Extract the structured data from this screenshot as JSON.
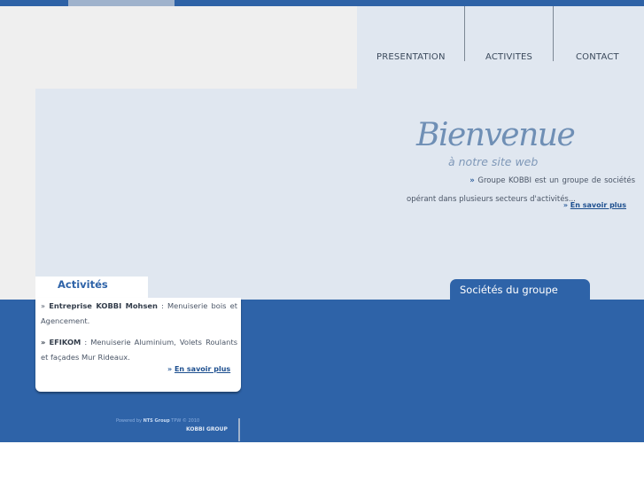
{
  "nav": {
    "items": [
      {
        "label": "PRESENTATION"
      },
      {
        "label": "ACTIVITES"
      },
      {
        "label": "CONTACT"
      }
    ]
  },
  "welcome": {
    "title": "Bienvenue",
    "subtitle": "à notre site web",
    "intro": "Groupe KOBBI est un groupe de sociétés opérant dans plusieurs secteurs d'activités...",
    "more_link": "En savoir plus"
  },
  "activities": {
    "title": "Activités",
    "items": [
      {
        "name": "Entreprise KOBBI Mohsen",
        "description": ": Menuiserie bois et Agencement."
      },
      {
        "name": "EFIKOM",
        "description": ": Menuiserie Aluminium, Volets Roulants et façades Mur Rideaux."
      }
    ],
    "more_link": "En savoir plus"
  },
  "companies": {
    "title": "Sociétés du groupe"
  },
  "footer": {
    "powered_by": "Powered by",
    "brand": "NTS Group",
    "year": "TPW © 2010",
    "company": "KOBBI GROUP"
  },
  "colors": {
    "primary_blue": "#2e62a6",
    "light_blue_bg": "#e0e7f0",
    "gray_bg": "#efefef",
    "link_blue": "#1d4f8f"
  }
}
